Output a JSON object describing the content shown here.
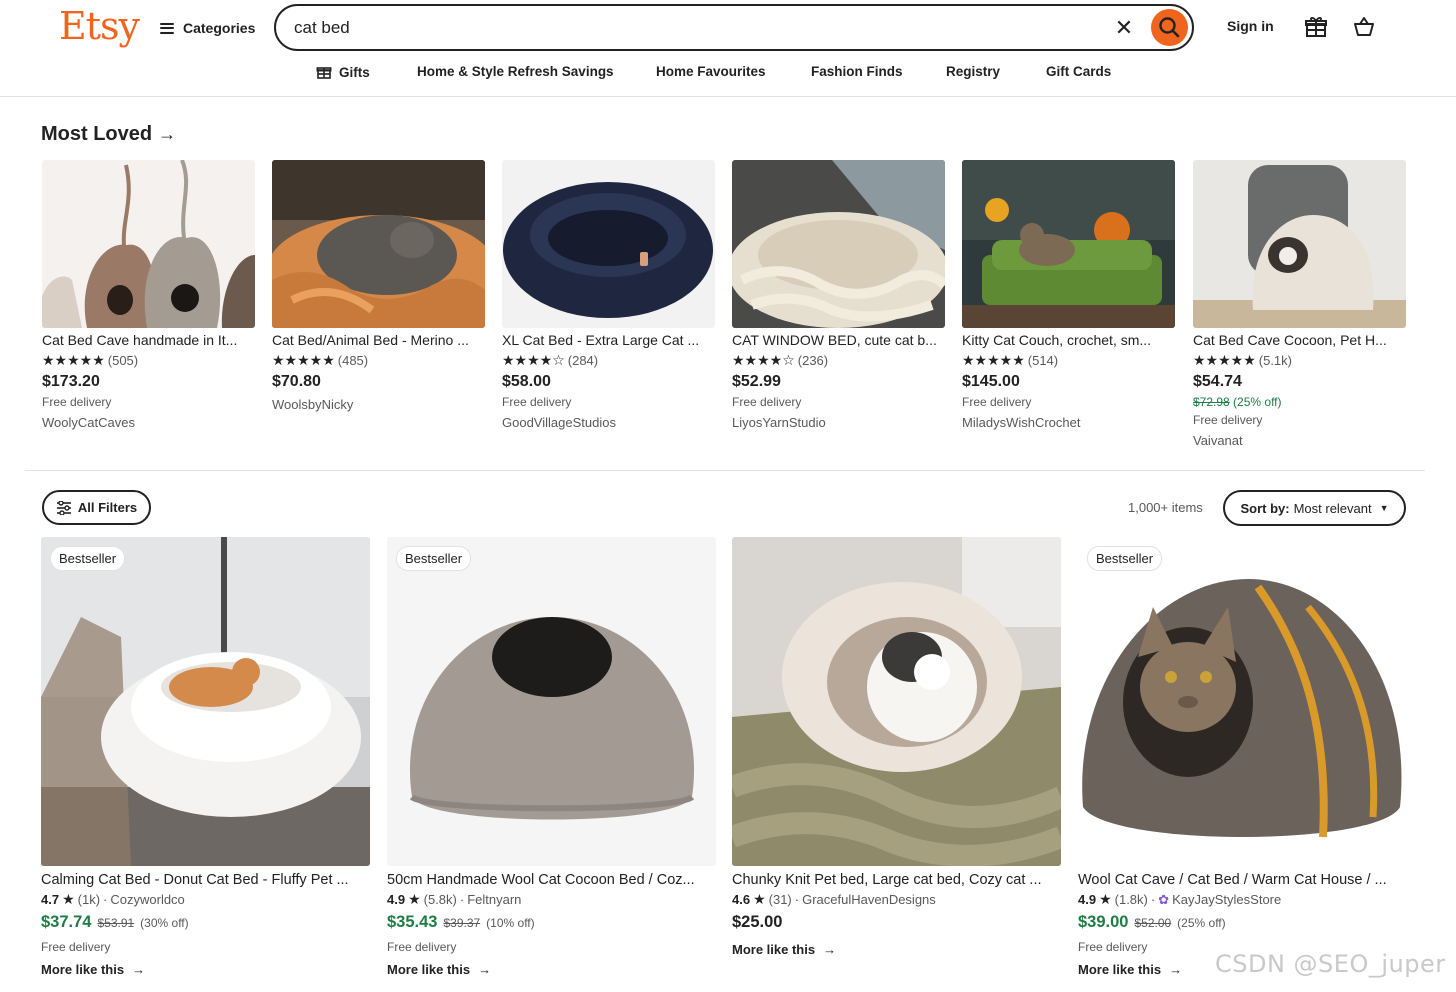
{
  "brand": {
    "logo_text": "Etsy",
    "accent_color": "#F1641E"
  },
  "header": {
    "categories_label": "Categories",
    "search_value": "cat bed",
    "clear_icon": "close-icon",
    "search_icon": "search-icon",
    "sign_in_label": "Sign in",
    "gift_icon": "gift-icon",
    "cart_icon": "shopping-bag-icon"
  },
  "nav": {
    "items": [
      {
        "label": "Gifts",
        "icon": "gift-icon"
      },
      {
        "label": "Home & Style Refresh Savings"
      },
      {
        "label": "Home Favourites"
      },
      {
        "label": "Fashion Finds"
      },
      {
        "label": "Registry"
      },
      {
        "label": "Gift Cards"
      }
    ]
  },
  "most_loved": {
    "title": "Most Loved",
    "items": [
      {
        "title": "Cat Bed Cave handmade in It...",
        "stars": "★★★★★",
        "reviews": "(505)",
        "price": "$173.20",
        "delivery": "Free delivery",
        "shop": "WoolyCatCaves"
      },
      {
        "title": "Cat Bed/Animal Bed - Merino ...",
        "stars": "★★★★★",
        "reviews": "(485)",
        "price": "$70.80",
        "shop": "WoolsbyNicky"
      },
      {
        "title": "XL Cat Bed - Extra Large Cat ...",
        "stars": "★★★★☆",
        "reviews": "(284)",
        "price": "$58.00",
        "delivery": "Free delivery",
        "shop": "GoodVillageStudios"
      },
      {
        "title": "CAT WINDOW BED, cute cat b...",
        "stars": "★★★★☆",
        "reviews": "(236)",
        "price": "$52.99",
        "delivery": "Free delivery",
        "shop": "LiyosYarnStudio"
      },
      {
        "title": "Kitty Cat Couch, crochet, sm...",
        "stars": "★★★★★",
        "reviews": "(514)",
        "price": "$145.00",
        "delivery": "Free delivery",
        "shop": "MiladysWishCrochet"
      },
      {
        "title": "Cat Bed Cave Cocoon, Pet H...",
        "stars": "★★★★★",
        "reviews": "(5.1k)",
        "price": "$54.74",
        "original_price": "$72.98",
        "discount": "(25% off)",
        "delivery": "Free delivery",
        "shop": "Vaivanat"
      }
    ]
  },
  "filter_bar": {
    "all_filters_label": "All Filters",
    "items_count": "1,000+ items",
    "sort_label_bold": "Sort by:",
    "sort_value": "Most relevant"
  },
  "results": [
    {
      "badge": "Bestseller",
      "title": "Calming Cat Bed - Donut Cat Bed - Fluffy Pet ...",
      "rating": "4.7",
      "reviews": "(1k)",
      "shop": "Cozyworldco",
      "price": "$37.74",
      "original_price": "$53.91",
      "discount": "(30% off)",
      "delivery": "Free delivery",
      "more_like": "More like this"
    },
    {
      "badge": "Bestseller",
      "title": "50cm Handmade Wool Cat Cocoon Bed / Coz...",
      "rating": "4.9",
      "reviews": "(5.8k)",
      "shop": "Feltnyarn",
      "price": "$35.43",
      "original_price": "$39.37",
      "discount": "(10% off)",
      "delivery": "Free delivery",
      "more_like": "More like this"
    },
    {
      "title": "Chunky Knit Pet bed, Large cat bed, Cozy cat ...",
      "rating": "4.6",
      "reviews": "(31)",
      "shop": "GracefulHavenDesigns",
      "price": "$25.00",
      "more_like": "More like this"
    },
    {
      "badge": "Bestseller",
      "title": "Wool Cat Cave / Cat Bed / Warm Cat House / ...",
      "rating": "4.9",
      "reviews": "(1.8k)",
      "shop": "KayJayStylesStore",
      "price": "$39.00",
      "original_price": "$52.00",
      "discount": "(25% off)",
      "delivery": "Free delivery",
      "more_like": "More like this"
    }
  ],
  "watermark": "CSDN @SEO_juper",
  "colors": {
    "sale_green": "#1e7c44",
    "text": "#222222",
    "muted": "#595959",
    "border": "#e1e3df"
  }
}
